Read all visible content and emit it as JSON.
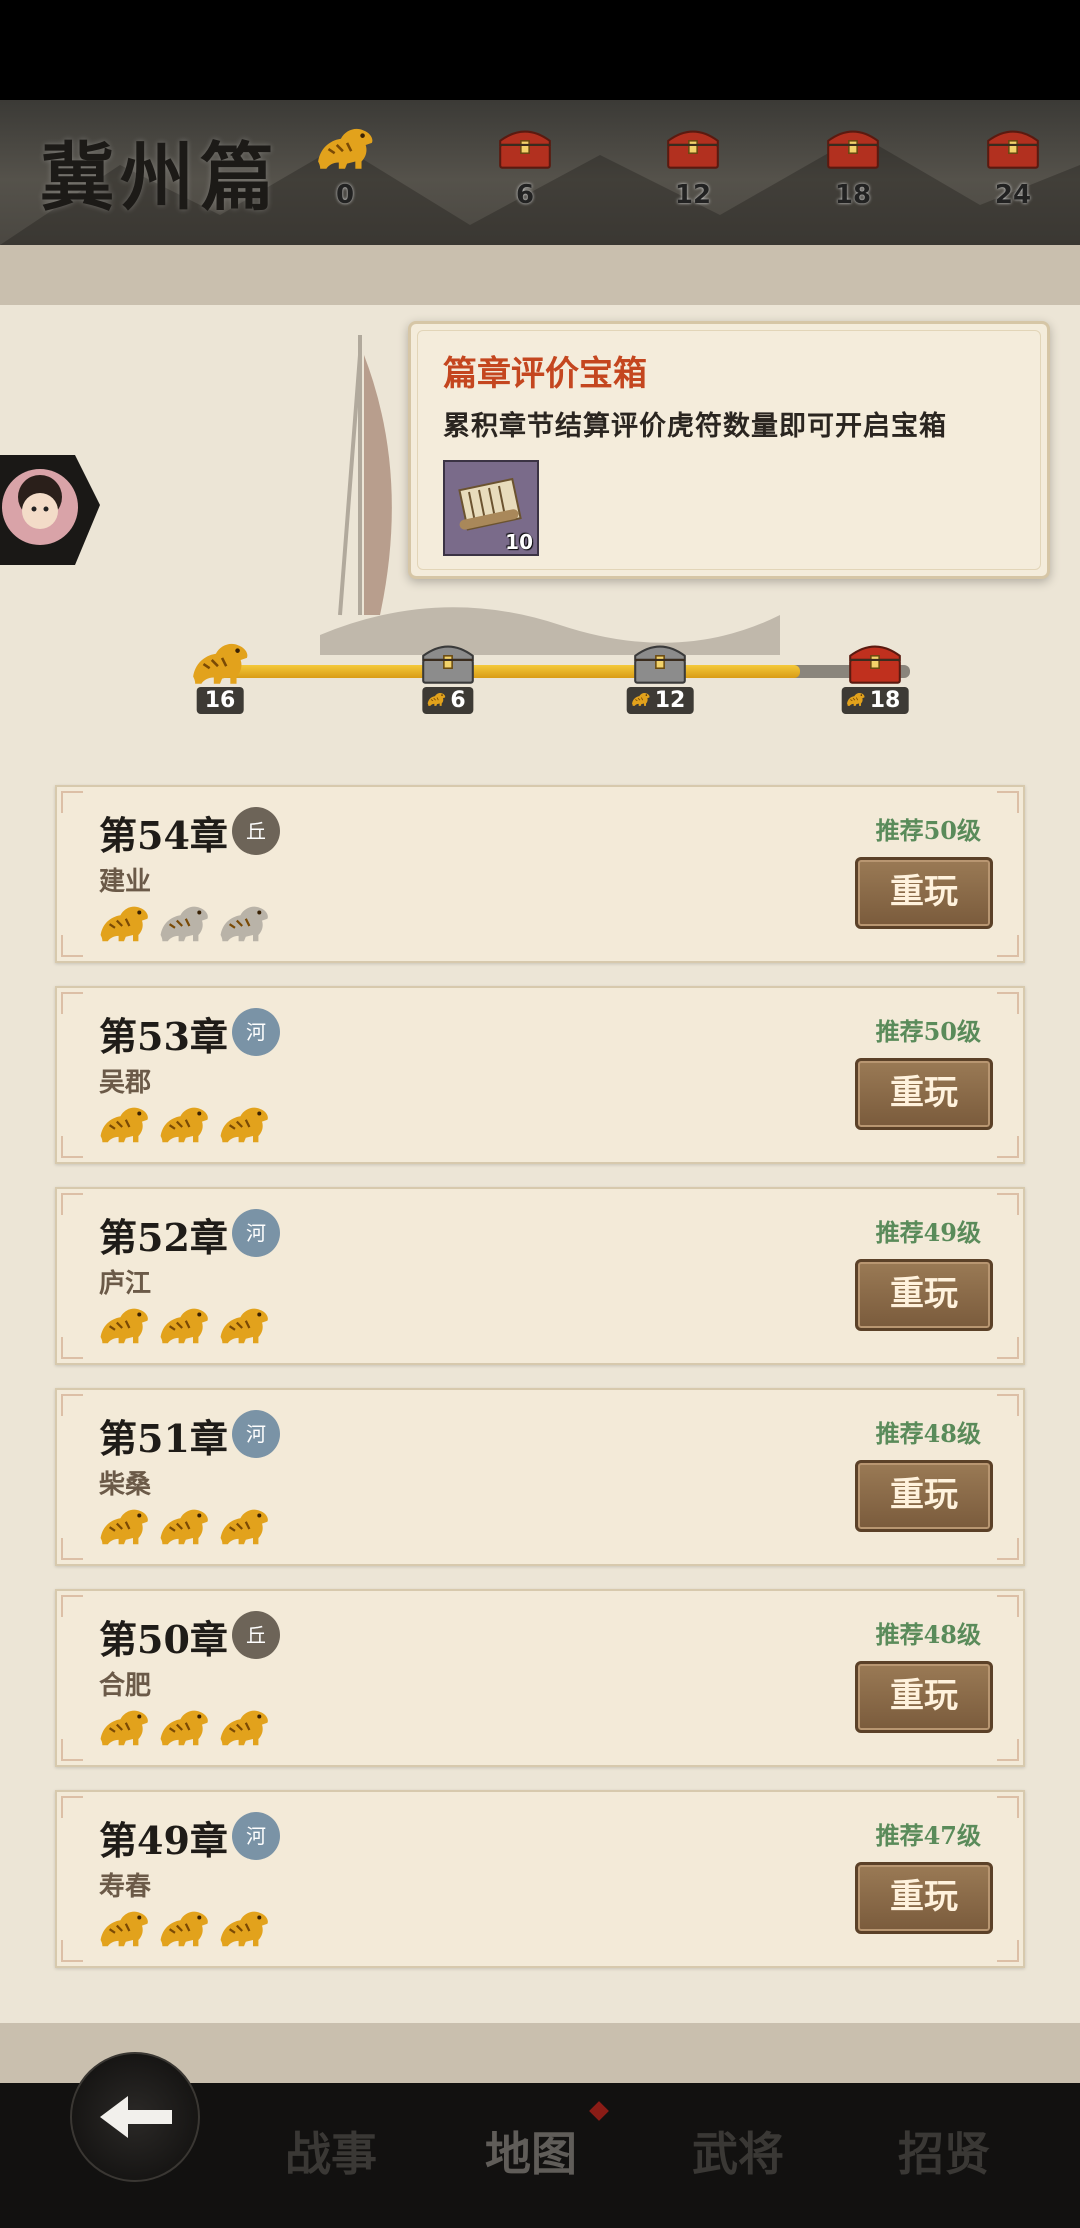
{
  "header": {
    "section_title": "冀州篇",
    "current_count": "0",
    "milestones": [
      "6",
      "12",
      "18",
      "24"
    ]
  },
  "tooltip": {
    "title": "篇章评价宝箱",
    "description": "累积章节结算评价虎符数量即可开启宝箱",
    "item_count": "10"
  },
  "progress": {
    "current": "16",
    "current_fraction": 0.84,
    "milestones": [
      {
        "value": "6",
        "chest": "silver"
      },
      {
        "value": "12",
        "chest": "silver"
      },
      {
        "value": "18",
        "chest": "red"
      }
    ]
  },
  "chapters": [
    {
      "title": "第54章",
      "terrain": "丘",
      "terrain_type": "hill",
      "place": "建业",
      "stars": 1,
      "recommend": "推荐50级",
      "button": "重玩"
    },
    {
      "title": "第53章",
      "terrain": "河",
      "terrain_type": "river",
      "place": "吴郡",
      "stars": 3,
      "recommend": "推荐50级",
      "button": "重玩"
    },
    {
      "title": "第52章",
      "terrain": "河",
      "terrain_type": "river",
      "place": "庐江",
      "stars": 3,
      "recommend": "推荐49级",
      "button": "重玩"
    },
    {
      "title": "第51章",
      "terrain": "河",
      "terrain_type": "river",
      "place": "柴桑",
      "stars": 3,
      "recommend": "推荐48级",
      "button": "重玩"
    },
    {
      "title": "第50章",
      "terrain": "丘",
      "terrain_type": "hill",
      "place": "合肥",
      "stars": 3,
      "recommend": "推荐48级",
      "button": "重玩"
    },
    {
      "title": "第49章",
      "terrain": "河",
      "terrain_type": "river",
      "place": "寿春",
      "stars": 3,
      "recommend": "推荐47级",
      "button": "重玩"
    }
  ],
  "nav": {
    "tabs": [
      "战事",
      "地图",
      "武将",
      "招贤"
    ],
    "active": "地图"
  },
  "colors": {
    "gold": "#e2a21c",
    "grey_star": "#b9b3a8",
    "accent_red": "#c4461f",
    "recommend_green": "#5a8b5a",
    "button_brown": "#7a5b3c"
  }
}
